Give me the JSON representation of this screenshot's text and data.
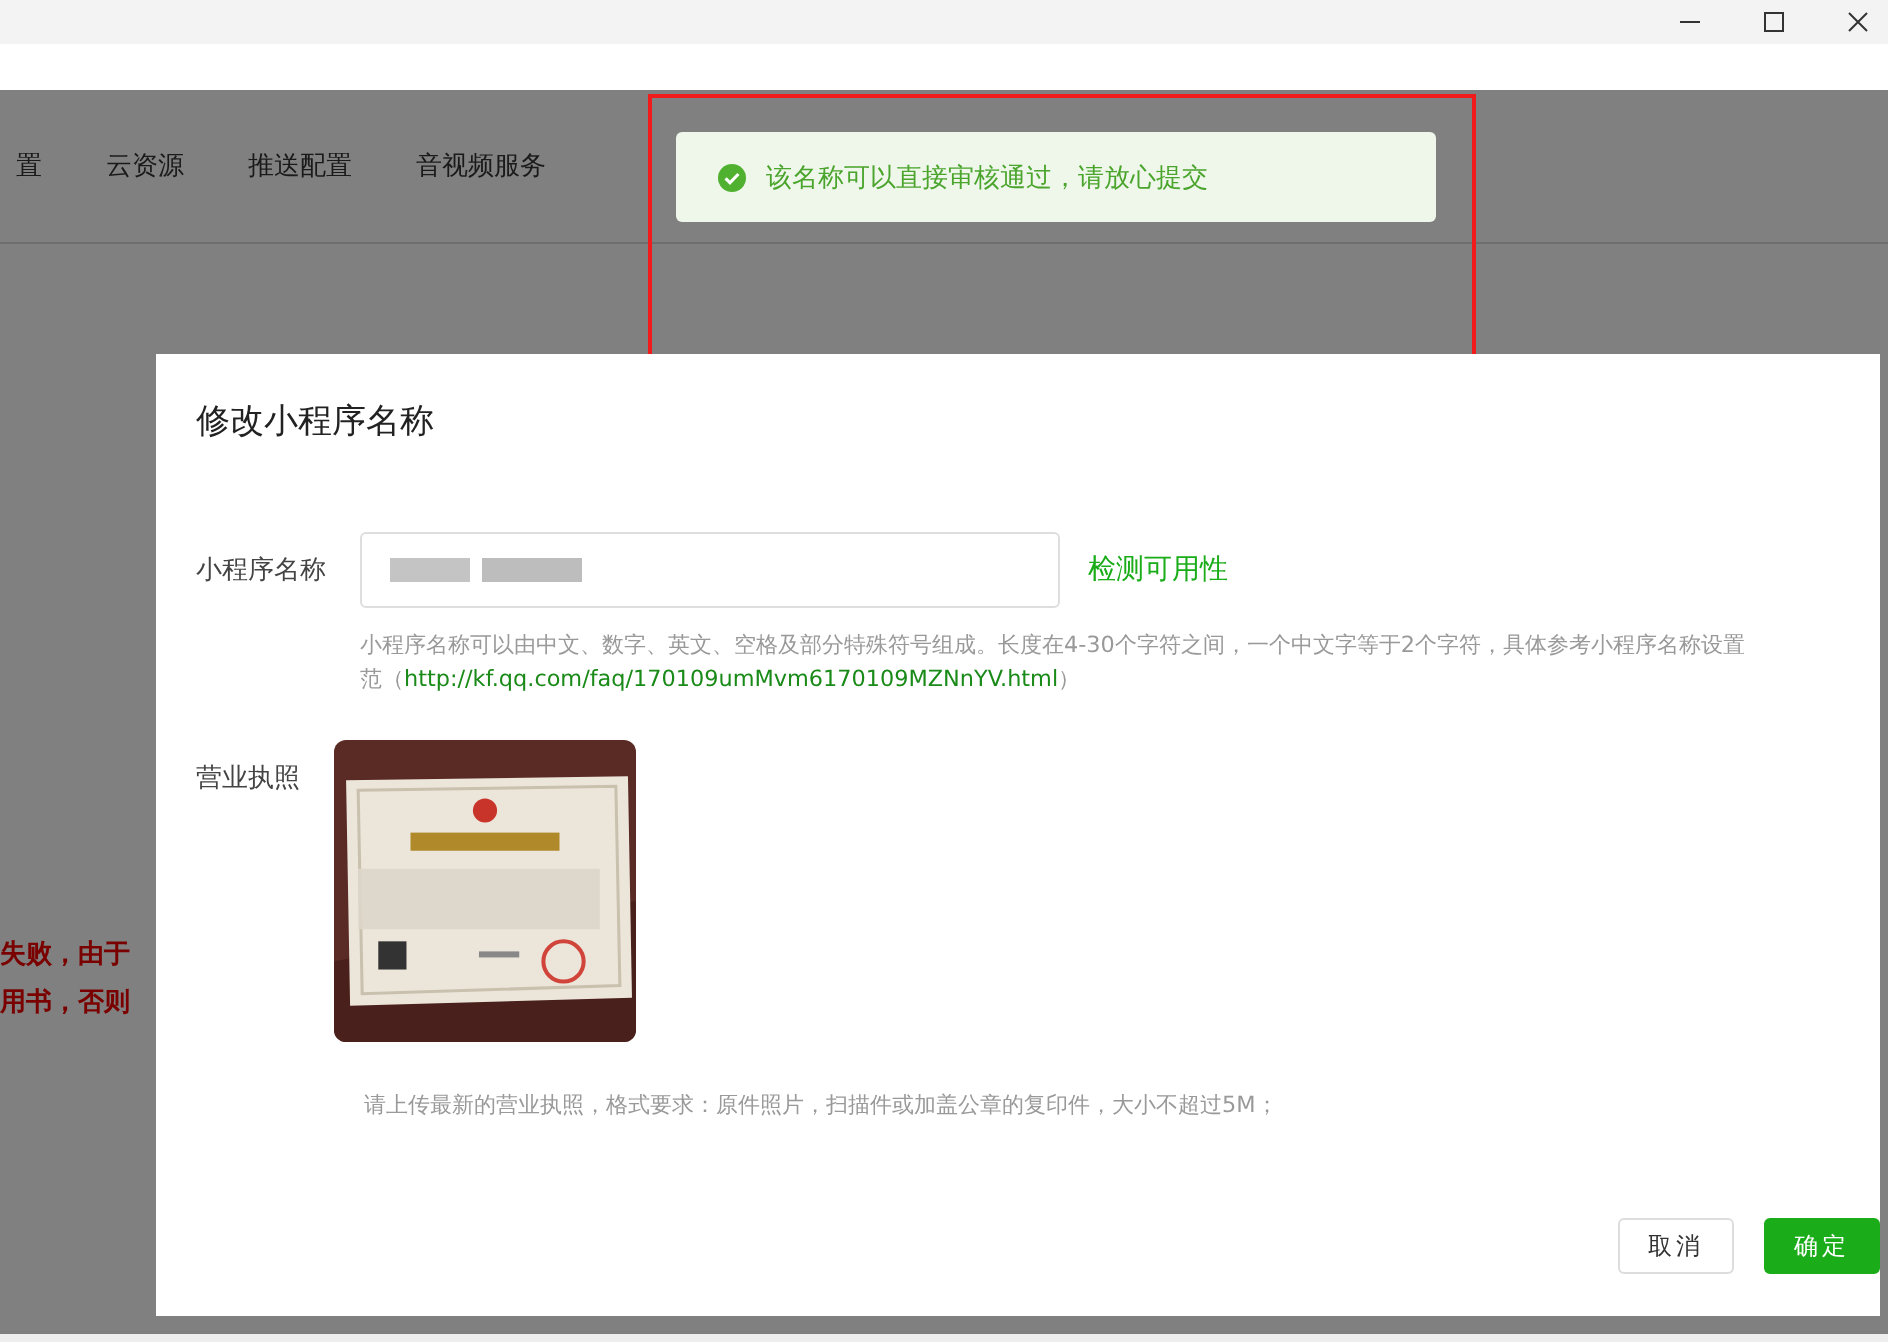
{
  "window": {
    "controls": [
      {
        "kind": "minimize"
      },
      {
        "kind": "maximize"
      },
      {
        "kind": "close"
      }
    ]
  },
  "nav": {
    "tabs": [
      {
        "label": "置"
      },
      {
        "label": "云资源"
      },
      {
        "label": "推送配置"
      },
      {
        "label": "音视频服务"
      }
    ]
  },
  "background_notice": {
    "lines": [
      "失败，由于",
      "用书，否则"
    ]
  },
  "toast": {
    "kind": "success",
    "message": "该名称可以直接审核通过，请放心提交"
  },
  "dialog": {
    "title": "修改小程序名称",
    "name_field": {
      "label": "小程序名称",
      "check_link": "检测可用性",
      "help_line": "小程序名称可以由中文、数字、英文、空格及部分特殊符号组成。长度在4-30个字符之间，一个中文字等于2个字符，具体参考小程序名称设置",
      "help_prefix": "范（",
      "help_link": "http://kf.qq.com/faq/170109umMvm6170109MZNnYV.html",
      "help_suffix": "）"
    },
    "license": {
      "label": "营业执照",
      "hint": "请上传最新的营业执照，格式要求：原件照片，扫描件或加盖公章的复印件，大小不超过5M；"
    },
    "buttons": [
      {
        "label": "取消",
        "kind": "secondary"
      },
      {
        "label": "确定",
        "kind": "primary"
      }
    ]
  }
}
